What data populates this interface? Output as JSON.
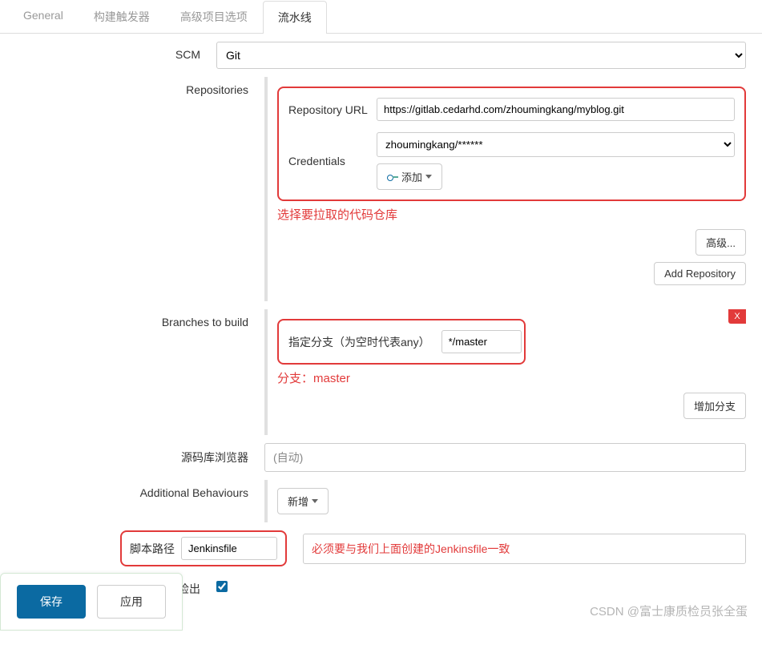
{
  "tabs": {
    "general": "General",
    "triggers": "构建触发器",
    "advanced": "高级项目选项",
    "pipeline": "流水线"
  },
  "scm": {
    "label": "SCM",
    "value": "Git"
  },
  "repositories": {
    "label": "Repositories",
    "url_label": "Repository URL",
    "url_value": "https://gitlab.cedarhd.com/zhoumingkang/myblog.git",
    "credentials_label": "Credentials",
    "credentials_value": "zhoumingkang/******",
    "add_label": "添加",
    "advanced_btn": "高级...",
    "add_repo_btn": "Add Repository",
    "annotation": "选择要拉取的代码仓库"
  },
  "branches": {
    "label": "Branches to build",
    "spec_label": "指定分支（为空时代表any）",
    "spec_value": "*/master",
    "delete_x": "X",
    "add_branch_btn": "增加分支",
    "annotation": "分支：master"
  },
  "repo_browser": {
    "label": "源码库浏览器",
    "value": "(自动)"
  },
  "behaviours": {
    "label": "Additional Behaviours",
    "add_btn": "新增"
  },
  "script": {
    "label": "脚本路径",
    "value": "Jenkinsfile",
    "annotation": "必须要与我们上面创建的Jenkinsfile一致"
  },
  "lightweight": {
    "label": "轻量级检出"
  },
  "footer": {
    "save": "保存",
    "apply": "应用"
  },
  "watermark": "CSDN @富士康质检员张全蛋"
}
